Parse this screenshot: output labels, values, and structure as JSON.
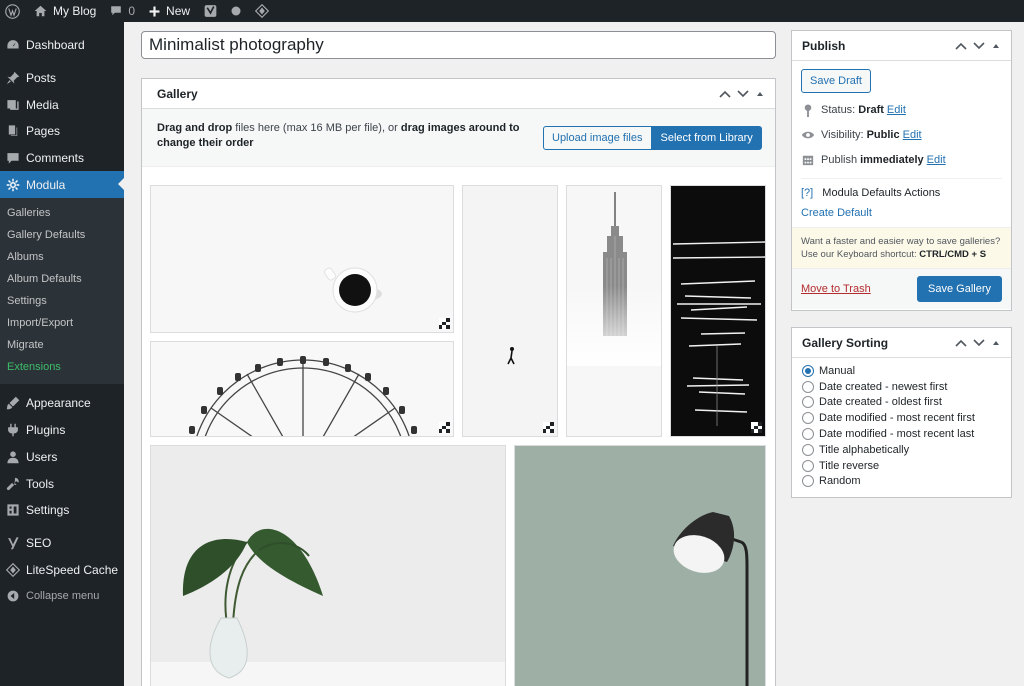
{
  "admin_bar": {
    "site_name": "My Blog",
    "comments_count": "0",
    "new_label": "New"
  },
  "sidebar": {
    "items_top": [
      {
        "label": "Dashboard",
        "icon": "dashboard-icon"
      },
      {
        "label": "Posts",
        "icon": "pushpin-icon"
      },
      {
        "label": "Media",
        "icon": "media-icon"
      },
      {
        "label": "Pages",
        "icon": "pages-icon"
      },
      {
        "label": "Comments",
        "icon": "comment-icon"
      },
      {
        "label": "Modula",
        "icon": "modula-gear-icon"
      }
    ],
    "submenu": [
      "Galleries",
      "Gallery Defaults",
      "Albums",
      "Album Defaults",
      "Settings",
      "Import/Export",
      "Migrate",
      "Extensions"
    ],
    "items_bottom": [
      {
        "label": "Appearance",
        "icon": "brush-icon"
      },
      {
        "label": "Plugins",
        "icon": "plugin-icon"
      },
      {
        "label": "Users",
        "icon": "users-icon"
      },
      {
        "label": "Tools",
        "icon": "wrench-icon"
      },
      {
        "label": "Settings",
        "icon": "settings-icon"
      }
    ],
    "items_extra": [
      {
        "label": "SEO",
        "icon": "yoast-icon"
      },
      {
        "label": "LiteSpeed Cache",
        "icon": "litespeed-icon"
      }
    ],
    "collapse_label": "Collapse menu"
  },
  "post": {
    "title_value": "Minimalist photography"
  },
  "gallery": {
    "title": "Gallery",
    "drop_bold_1": "Drag and drop",
    "drop_mid": " files here (max 16 MB per file), or ",
    "drop_bold_2": "drag images around to change their order",
    "upload_label": "Upload image files",
    "library_label": "Select from Library"
  },
  "publish": {
    "title": "Publish",
    "save_draft_label": "Save Draft",
    "status_label": "Status:",
    "status_value": "Draft",
    "visibility_label": "Visibility:",
    "visibility_value": "Public",
    "publish_label": "Publish",
    "publish_value": "immediately",
    "edit_label": "Edit",
    "defaults_q": "[?]",
    "defaults_label": "Modula Defaults Actions",
    "create_default_label": "Create Default",
    "shortcut_text": "Want a faster and easier way to save galleries? Use our Keyboard shortcut:",
    "shortcut_keys": "CTRL/CMD + S",
    "trash_label": "Move to Trash",
    "save_gallery_label": "Save Gallery"
  },
  "sorting": {
    "title": "Gallery Sorting",
    "options": [
      "Manual",
      "Date created - newest first",
      "Date created - oldest first",
      "Date modified - most recent first",
      "Date modified - most recent last",
      "Title alphabetically",
      "Title reverse",
      "Random"
    ],
    "selected": "Manual"
  },
  "colors": {
    "admin_dark": "#1d2327",
    "accent": "#2271b1",
    "extensions_green": "#3dbc69",
    "trash_red": "#b32d2e",
    "notice_bg": "#fcf9e8"
  }
}
